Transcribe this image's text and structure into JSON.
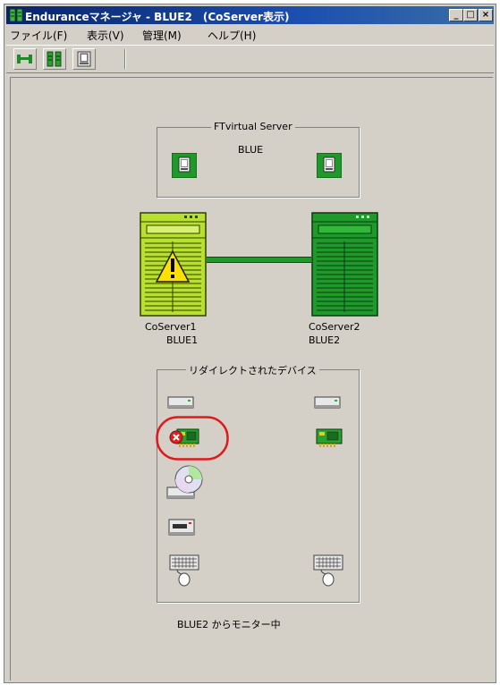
{
  "window": {
    "title": "Enduranceマネージャ - BLUE2　(CoServer表示)",
    "controls": {
      "minimize": "_",
      "maximize": "□",
      "close": "×"
    }
  },
  "menu": {
    "file": "ファイル(F)",
    "view": "表示(V)",
    "manage": "管理(M)",
    "help": "ヘルプ(H)"
  },
  "toolbar": {
    "buttons": [
      "connection-icon",
      "coserver-pair-icon",
      "virtual-server-icon"
    ]
  },
  "ftvirtual": {
    "group_title": "FTvirtual Server",
    "name": "BLUE"
  },
  "coservers": [
    {
      "name": "CoServer1",
      "host": "BLUE1",
      "status": "warning"
    },
    {
      "name": "CoServer2",
      "host": "BLUE2",
      "status": "ok"
    }
  ],
  "devices": {
    "group_title": "リダイレクトされたデバイス",
    "rows": [
      {
        "icon": "disk-drive-icon",
        "left": true,
        "right": true
      },
      {
        "icon": "network-card-icon",
        "left": true,
        "left_status": "error",
        "right": true
      },
      {
        "icon": "cdrom-drive-icon",
        "left": true,
        "right": false
      },
      {
        "icon": "tape-drive-icon",
        "left": true,
        "right": false
      },
      {
        "icon": "keyboard-mouse-icon",
        "left": true,
        "right": true
      }
    ]
  },
  "status": {
    "monitoring": "BLUE2 からモニター中"
  },
  "colors": {
    "server_warning": "#b8e030",
    "server_ok": "#1f9a2a",
    "highlight_ring": "#e01a1a",
    "title_bar": "#0a246a"
  }
}
